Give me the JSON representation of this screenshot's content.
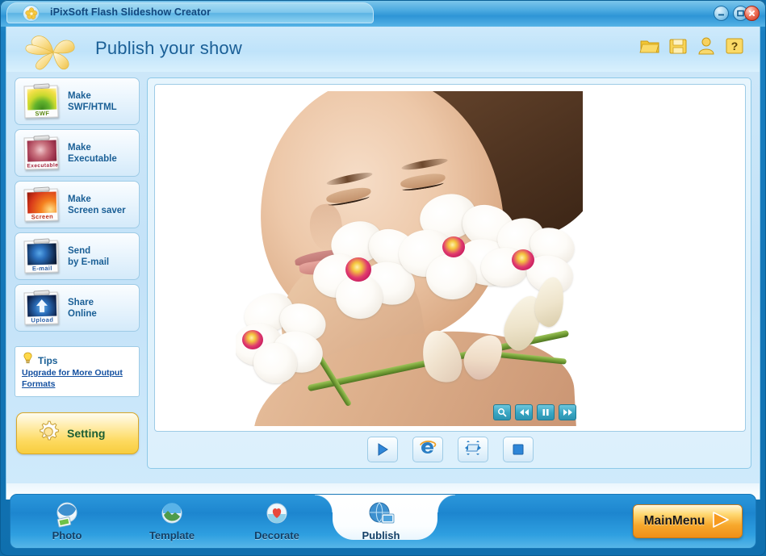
{
  "window": {
    "title": "iPixSoft Flash Slideshow Creator",
    "app_logo_icon": "flower-logo-icon",
    "controls": {
      "minimize": "minimize-icon",
      "maximize": "maximize-icon",
      "close": "close-icon"
    },
    "accent_blue": "#1a7fc1",
    "panel_blue": "#cce7f9",
    "title_text_color": "#12487e"
  },
  "header": {
    "page_title": "Publish your show",
    "logo_icon": "pinwheel-flower-icon",
    "toolbar": [
      {
        "name": "open-folder-button",
        "icon": "folder-open-icon"
      },
      {
        "name": "save-button",
        "icon": "floppy-disk-icon"
      },
      {
        "name": "user-account-button",
        "icon": "user-icon"
      },
      {
        "name": "help-button",
        "icon": "question-mark-icon"
      }
    ]
  },
  "sidebar": {
    "items": [
      {
        "line1": "Make",
        "line2": "SWF/HTML",
        "tag": "SWF",
        "icon": "swf-photo-icon",
        "name": "make-swf-html-button"
      },
      {
        "line1": "Make",
        "line2": "Executable",
        "tag": "Executable",
        "icon": "executable-photo-icon",
        "name": "make-executable-button"
      },
      {
        "line1": "Make",
        "line2": "Screen saver",
        "tag": "Screen",
        "icon": "screensaver-photo-icon",
        "name": "make-screensaver-button"
      },
      {
        "line1": "Send",
        "line2": "by E-mail",
        "tag": "E-mail",
        "icon": "email-photo-icon",
        "name": "send-by-email-button"
      },
      {
        "line1": "Share",
        "line2": "Online",
        "tag": "Upload",
        "icon": "upload-photo-icon",
        "name": "share-online-button"
      }
    ],
    "tips": {
      "title": "Tips",
      "icon": "lightbulb-icon",
      "link": "Upgrade for More Output Formats"
    },
    "setting": {
      "label": "Setting",
      "icon": "gear-icon"
    }
  },
  "preview": {
    "slide_alt": "Woman with white orchids spa photo",
    "overlay_controls": [
      {
        "name": "zoom-preview-button",
        "icon": "magnifier-icon",
        "glyph": "search"
      },
      {
        "name": "rewind-button",
        "icon": "rewind-icon",
        "glyph": "rewind"
      },
      {
        "name": "pause-button",
        "icon": "pause-icon",
        "glyph": "pause"
      },
      {
        "name": "forward-button",
        "icon": "fast-forward-icon",
        "glyph": "forward"
      }
    ],
    "transport_controls": [
      {
        "name": "play-button",
        "icon": "play-icon"
      },
      {
        "name": "browser-preview-button",
        "icon": "internet-explorer-icon"
      },
      {
        "name": "resize-preview-button",
        "icon": "resize-arrows-icon"
      },
      {
        "name": "stop-button",
        "icon": "stop-icon"
      }
    ]
  },
  "nav": {
    "tabs": [
      {
        "label": "Photo",
        "icon": "photo-globe-icon",
        "active": false
      },
      {
        "label": "Template",
        "icon": "template-globe-icon",
        "active": false
      },
      {
        "label": "Decorate",
        "icon": "heart-globe-icon",
        "active": false
      },
      {
        "label": "Publish",
        "icon": "publish-globe-icon",
        "active": true
      }
    ],
    "main_menu": {
      "label": "MainMenu",
      "icon": "arrow-right-icon",
      "color": "#f7a82c"
    }
  }
}
